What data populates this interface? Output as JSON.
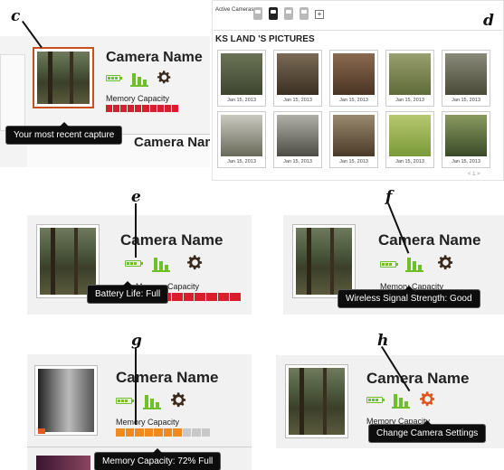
{
  "captions": {
    "c": "c",
    "d": "d",
    "e": "e",
    "f": "f",
    "g": "g",
    "h": "h"
  },
  "camera_name": "Camera Name",
  "memory_label": "Memory Capacity",
  "tooltips": {
    "recent_capture": "Your most recent capture",
    "battery": "Battery Life: Full",
    "signal": "Wireless Signal Strength: Good",
    "memory": "Memory Capacity: 72% Full",
    "settings": "Change Camera Settings"
  },
  "panel_d": {
    "active_cameras_label": "Active Cameras:",
    "add_symbol": "+",
    "gallery_title": "KS LAND 'S PICTURES",
    "photos": [
      {
        "date": "Jan 15, 2013"
      },
      {
        "date": "Jan 15, 2013"
      },
      {
        "date": "Jan 15, 2013"
      },
      {
        "date": "Jan 15, 2013"
      },
      {
        "date": "Jan 15, 2013"
      },
      {
        "date": "Jan 15, 2013"
      },
      {
        "date": "Jan 15, 2013"
      },
      {
        "date": "Jan 15, 2013"
      },
      {
        "date": "Jan 15, 2013"
      },
      {
        "date": "Jan 15, 2013"
      }
    ],
    "pager": "< 1 >"
  },
  "memory_states": {
    "full_red": {
      "fraction": 1.0,
      "color": "#d81e2c"
    },
    "g_orange": {
      "fraction": 0.72,
      "color": "#f08a1c",
      "empty_color": "#c8c8c8"
    }
  },
  "colors": {
    "green": "#6fbf2b",
    "gear": "#3a2a1e",
    "gear_active": "#e0551c",
    "highlight_border": "#c8501e"
  },
  "icons": [
    "battery-icon",
    "signal-icon",
    "gear-icon",
    "camera-icon"
  ]
}
